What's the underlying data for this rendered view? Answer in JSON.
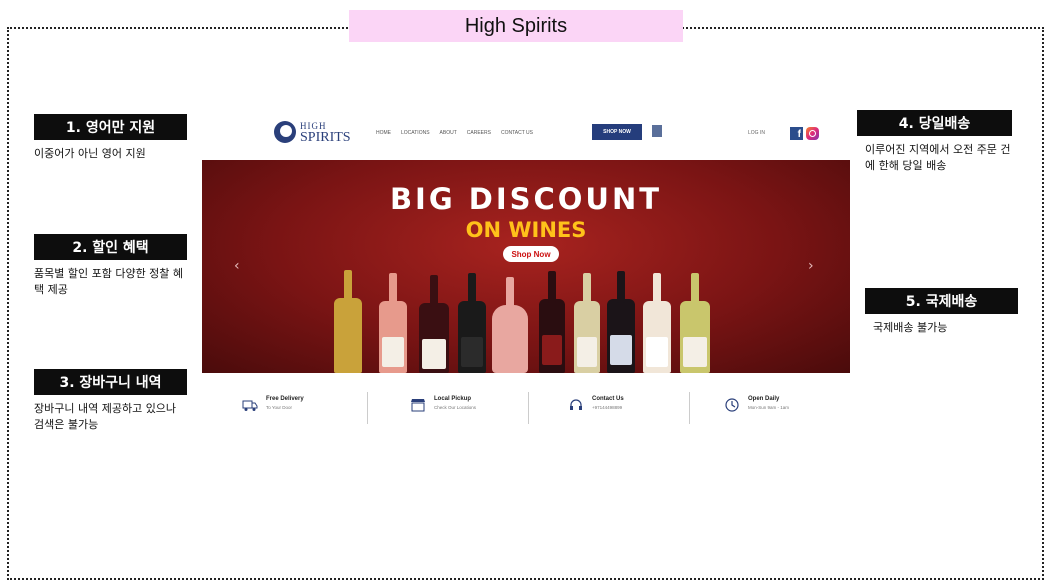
{
  "slide": {
    "title": "High Spirits"
  },
  "callouts": [
    {
      "label": "1. 영어만 지원",
      "desc": "이중어가 아닌 영어 지원"
    },
    {
      "label": "2. 할인 혜택",
      "desc": "품목별 할인 포함 다양한 정찰 혜택 제공"
    },
    {
      "label": "3. 장바구니 내역",
      "desc": "장바구니 내역 제공하고 있으나 검색은 불가능"
    },
    {
      "label": "4. 당일배송",
      "desc": "이루어진 지역에서 오전 주문 건에 한해 당일 배송"
    },
    {
      "label": "5. 국제배송",
      "desc": "국제배송 불가능"
    }
  ],
  "site": {
    "logo_line1": "HIGH",
    "logo_line2": "SPIRITS",
    "nav": [
      "HOME",
      "LOCATIONS",
      "ABOUT",
      "CAREERS",
      "CONTACT US"
    ],
    "shop_now": "SHOP NOW",
    "login": "LOG IN",
    "fb_letter": "f",
    "hero": {
      "title": "BIG DISCOUNT",
      "subtitle": "ON WINES",
      "button": "Shop Now",
      "arrow_left": "‹",
      "arrow_right": "›"
    },
    "features": [
      {
        "title": "Free Delivery",
        "sub": "To Your Door",
        "icon": "truck-icon"
      },
      {
        "title": "Local Pickup",
        "sub": "Check Our Locations",
        "icon": "store-icon"
      },
      {
        "title": "Contact Us",
        "sub": "+97144498899",
        "icon": "headset-icon"
      },
      {
        "title": "Open Daily",
        "sub": "Mon-Sun 9am - 1am",
        "icon": "clock-icon"
      }
    ]
  },
  "colors": {
    "title_bg": "#fbd5f6",
    "callout_bg": "#0d0d0d",
    "brand_blue": "#253d7c",
    "hero_red": "#8a1a17",
    "hero_gold": "#ffc21a"
  }
}
